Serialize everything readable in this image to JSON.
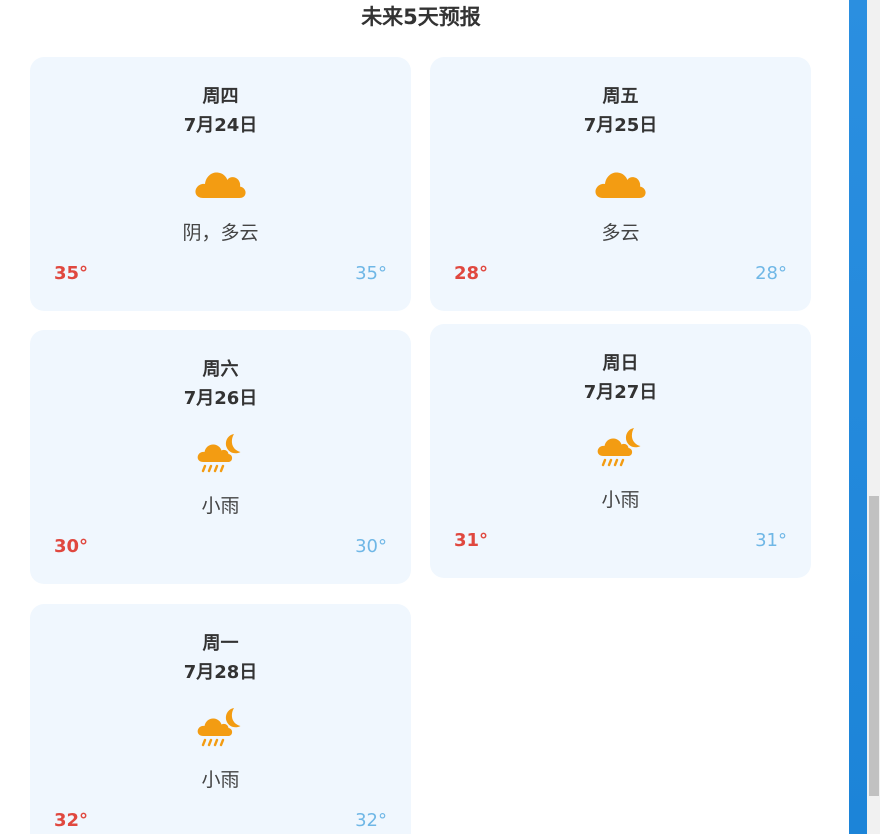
{
  "section": {
    "title": "未来5天预报"
  },
  "forecast": [
    {
      "weekday": "周四",
      "date": "7月24日",
      "icon": "cloud-icon",
      "description": "阴，多云",
      "high": "35°",
      "low": "35°"
    },
    {
      "weekday": "周五",
      "date": "7月25日",
      "icon": "cloud-icon",
      "description": "多云",
      "high": "28°",
      "low": "28°"
    },
    {
      "weekday": "周六",
      "date": "7月26日",
      "icon": "night-rain-icon",
      "description": "小雨",
      "high": "30°",
      "low": "30°"
    },
    {
      "weekday": "周日",
      "date": "7月27日",
      "icon": "night-rain-icon",
      "description": "小雨",
      "high": "31°",
      "low": "31°"
    },
    {
      "weekday": "周一",
      "date": "7月28日",
      "icon": "night-rain-icon",
      "description": "小雨",
      "high": "32°",
      "low": "32°"
    }
  ],
  "colors": {
    "card_background": "#f0f7fe",
    "icon": "#f39c12",
    "high_temp": "#e0483f",
    "low_temp": "#6fb7e6",
    "text": "#333333",
    "accent_bar": "#1c84d8"
  }
}
